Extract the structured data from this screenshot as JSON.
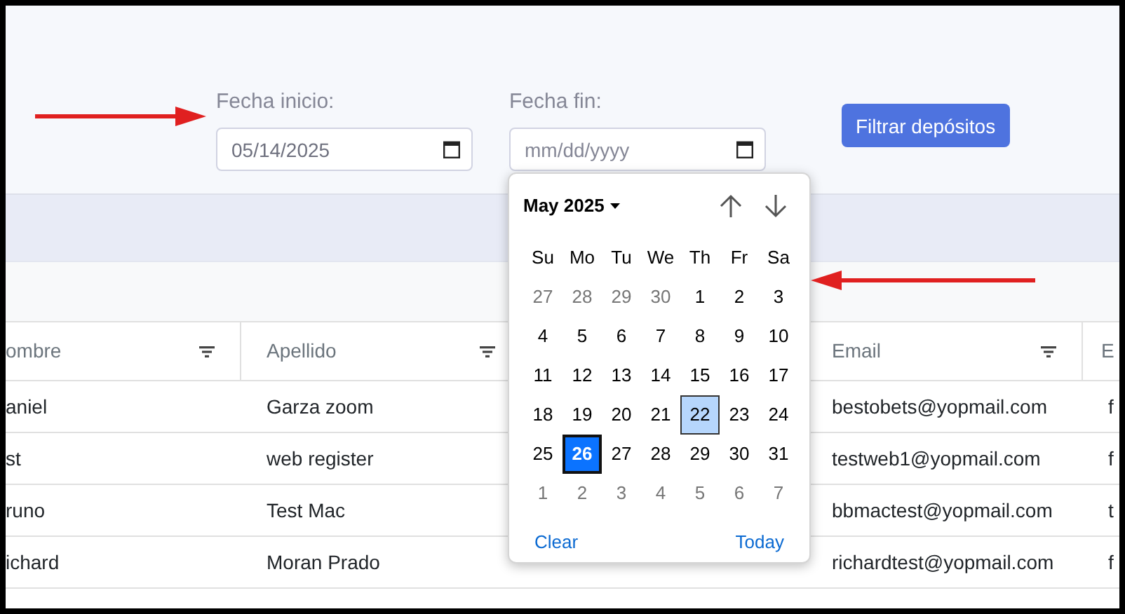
{
  "filters": [
    {
      "label": "Fecha inicio:",
      "value": "05/14/2025"
    },
    {
      "label": "Fecha fin:",
      "placeholder": "mm/dd/yyyy"
    }
  ],
  "filter_button": "Filtrar depósitos",
  "datepicker": {
    "month_label": "May 2025",
    "weekdays": [
      "Su",
      "Mo",
      "Tu",
      "We",
      "Th",
      "Fr",
      "Sa"
    ],
    "weeks": [
      [
        {
          "label": "27",
          "outside": true,
          "selected": false,
          "highlighted": false
        },
        {
          "label": "28",
          "outside": true,
          "selected": false,
          "highlighted": false
        },
        {
          "label": "29",
          "outside": true,
          "selected": false,
          "highlighted": false
        },
        {
          "label": "30",
          "outside": true,
          "selected": false,
          "highlighted": false
        },
        {
          "label": "1",
          "outside": false,
          "selected": false,
          "highlighted": false
        },
        {
          "label": "2",
          "outside": false,
          "selected": false,
          "highlighted": false
        },
        {
          "label": "3",
          "outside": false,
          "selected": false,
          "highlighted": false
        }
      ],
      [
        {
          "label": "4",
          "outside": false,
          "selected": false,
          "highlighted": false
        },
        {
          "label": "5",
          "outside": false,
          "selected": false,
          "highlighted": false
        },
        {
          "label": "6",
          "outside": false,
          "selected": false,
          "highlighted": false
        },
        {
          "label": "7",
          "outside": false,
          "selected": false,
          "highlighted": false
        },
        {
          "label": "8",
          "outside": false,
          "selected": false,
          "highlighted": false
        },
        {
          "label": "9",
          "outside": false,
          "selected": false,
          "highlighted": false
        },
        {
          "label": "10",
          "outside": false,
          "selected": false,
          "highlighted": false
        }
      ],
      [
        {
          "label": "11",
          "outside": false,
          "selected": false,
          "highlighted": false
        },
        {
          "label": "12",
          "outside": false,
          "selected": false,
          "highlighted": false
        },
        {
          "label": "13",
          "outside": false,
          "selected": false,
          "highlighted": false
        },
        {
          "label": "14",
          "outside": false,
          "selected": false,
          "highlighted": false
        },
        {
          "label": "15",
          "outside": false,
          "selected": false,
          "highlighted": false
        },
        {
          "label": "16",
          "outside": false,
          "selected": false,
          "highlighted": false
        },
        {
          "label": "17",
          "outside": false,
          "selected": false,
          "highlighted": false
        }
      ],
      [
        {
          "label": "18",
          "outside": false,
          "selected": false,
          "highlighted": false
        },
        {
          "label": "19",
          "outside": false,
          "selected": false,
          "highlighted": false
        },
        {
          "label": "20",
          "outside": false,
          "selected": false,
          "highlighted": false
        },
        {
          "label": "21",
          "outside": false,
          "selected": false,
          "highlighted": false
        },
        {
          "label": "22",
          "outside": false,
          "selected": false,
          "highlighted": true
        },
        {
          "label": "23",
          "outside": false,
          "selected": false,
          "highlighted": false
        },
        {
          "label": "24",
          "outside": false,
          "selected": false,
          "highlighted": false
        }
      ],
      [
        {
          "label": "25",
          "outside": false,
          "selected": false,
          "highlighted": false
        },
        {
          "label": "26",
          "outside": false,
          "selected": true,
          "highlighted": false
        },
        {
          "label": "27",
          "outside": false,
          "selected": false,
          "highlighted": false
        },
        {
          "label": "28",
          "outside": false,
          "selected": false,
          "highlighted": false
        },
        {
          "label": "29",
          "outside": false,
          "selected": false,
          "highlighted": false
        },
        {
          "label": "30",
          "outside": false,
          "selected": false,
          "highlighted": false
        },
        {
          "label": "31",
          "outside": false,
          "selected": false,
          "highlighted": false
        }
      ],
      [
        {
          "label": "1",
          "outside": true,
          "selected": false,
          "highlighted": false
        },
        {
          "label": "2",
          "outside": true,
          "selected": false,
          "highlighted": false
        },
        {
          "label": "3",
          "outside": true,
          "selected": false,
          "highlighted": false
        },
        {
          "label": "4",
          "outside": true,
          "selected": false,
          "highlighted": false
        },
        {
          "label": "5",
          "outside": true,
          "selected": false,
          "highlighted": false
        },
        {
          "label": "6",
          "outside": true,
          "selected": false,
          "highlighted": false
        },
        {
          "label": "7",
          "outside": true,
          "selected": false,
          "highlighted": false
        }
      ]
    ],
    "clear": "Clear",
    "today": "Today"
  },
  "table": {
    "columns": [
      {
        "label": "ombre",
        "filterable": true
      },
      {
        "label": "Apellido",
        "filterable": true
      },
      {
        "label": "Email",
        "filterable": true
      },
      {
        "label": "E"
      }
    ],
    "rows": [
      [
        "aniel",
        "Garza zoom",
        "bestobets@yopmail.com",
        "f"
      ],
      [
        "st",
        "web register",
        "testweb1@yopmail.com",
        "f"
      ],
      [
        "runo",
        "Test Mac",
        "bbmactest@yopmail.com",
        "t"
      ],
      [
        "ichard",
        "Moran Prado",
        "richardtest@yopmail.com",
        "f"
      ]
    ]
  }
}
